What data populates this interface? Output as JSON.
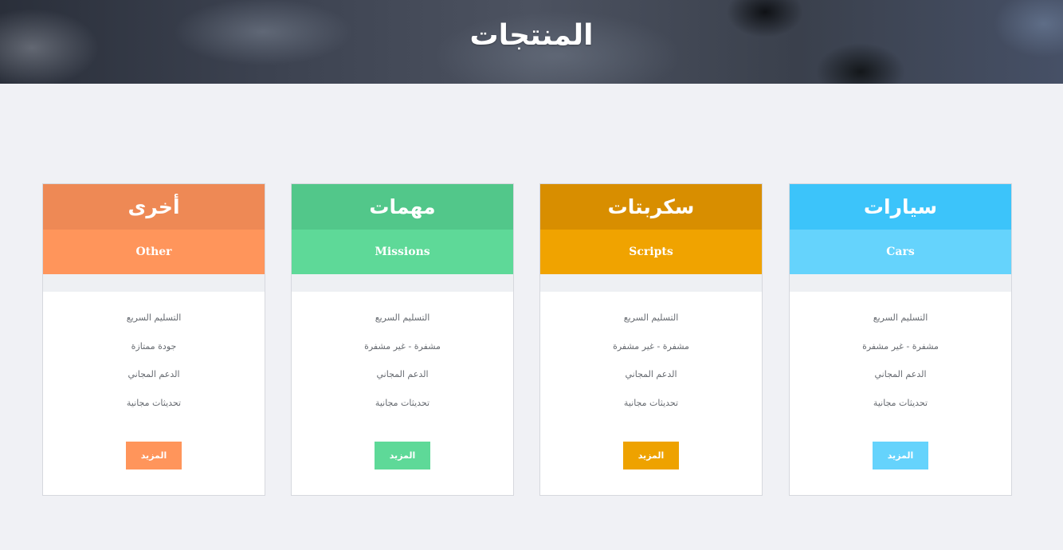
{
  "header": {
    "title": "المنتجات"
  },
  "cards": [
    {
      "title": "سيارات",
      "subtitle": "Cars",
      "head_color": "#3cc4fa",
      "sub_color": "#65d3fc",
      "button_color": "#65d3fc",
      "features": [
        "التسليم السريع",
        "مشفرة - غير مشفرة",
        "الدعم المجاني",
        "تحديثات مجانية"
      ],
      "button_label": "المزيد"
    },
    {
      "title": "سكربتات",
      "subtitle": "Scripts",
      "head_color": "#d88e00",
      "sub_color": "#f0a300",
      "button_color": "#eea200",
      "features": [
        "التسليم السريع",
        "مشفرة - غير مشفرة",
        "الدعم المجاني",
        "تحديثات مجانية"
      ],
      "button_label": "المزيد"
    },
    {
      "title": "مهمات",
      "subtitle": "Missions",
      "head_color": "#52c78a",
      "sub_color": "#5ed998",
      "button_color": "#5ed998",
      "features": [
        "التسليم السريع",
        "مشفرة - غير مشفرة",
        "الدعم المجاني",
        "تحديثات مجانية"
      ],
      "button_label": "المزيد"
    },
    {
      "title": "أخرى",
      "subtitle": "Other",
      "head_color": "#ee8955",
      "sub_color": "#ff955b",
      "button_color": "#ff955b",
      "features": [
        "التسليم السريع",
        "جودة ممتازة",
        "الدعم المجاني",
        "تحديثات مجانية"
      ],
      "button_label": "المزيد"
    }
  ]
}
